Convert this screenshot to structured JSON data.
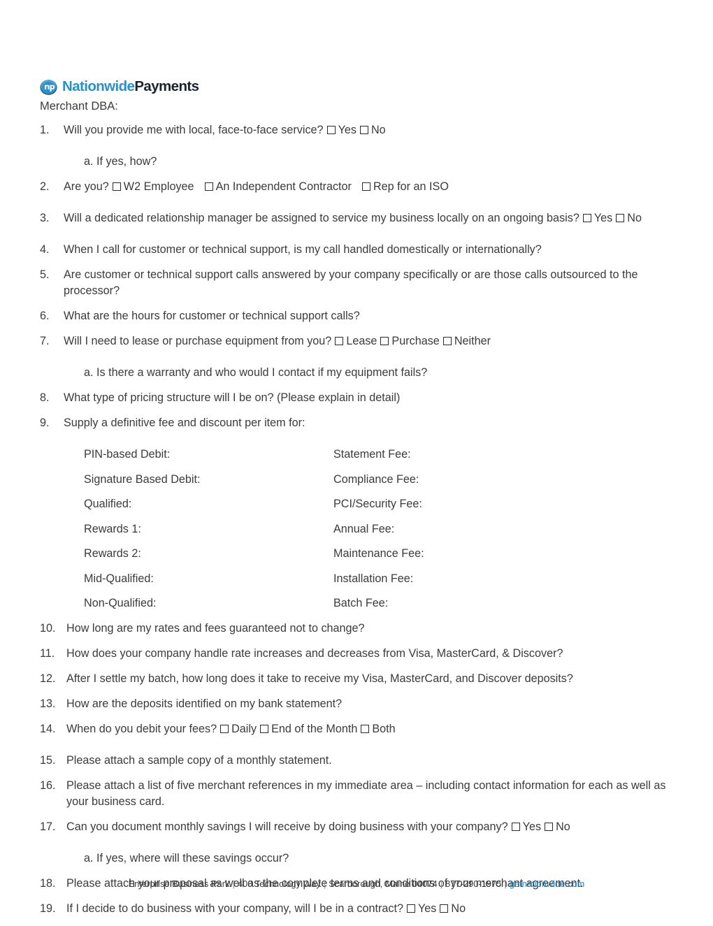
{
  "logo": {
    "mark_alt": "np-circle-logo",
    "word_primary": "Nationwide",
    "word_secondary": "Payments",
    "primary_color": "#2b8fc9",
    "secondary_color": "#1a2430"
  },
  "header": {
    "merchant_dba_label": "Merchant DBA:"
  },
  "questions": [
    {
      "num": "1.",
      "text": "Will you provide me with local, face-to-face service?",
      "options": [
        "Yes",
        "No"
      ]
    },
    {
      "num": "2.",
      "text": "Are you?",
      "options": [
        "W2 Employee",
        "An Independent Contractor",
        "Rep for an ISO"
      ]
    },
    {
      "num": "3.",
      "text": "Will a dedicated relationship manager be assigned to service my business locally on an ongoing basis?",
      "options": [
        "Yes",
        "No"
      ]
    },
    {
      "num": "4.",
      "text": "When I call for customer or technical support, is my call handled domestically or internationally?",
      "options": []
    },
    {
      "num": "5.",
      "text": "Are customer or technical support calls answered by your company specifically or are those calls outsourced to the processor?",
      "options": []
    },
    {
      "num": "6.",
      "text": "What are the hours for customer or technical support calls?",
      "options": []
    },
    {
      "num": "7.",
      "text": "Will I need to lease or purchase equipment from you?",
      "options": [
        "Lease",
        "Purchase",
        "Neither"
      ]
    },
    {
      "num": "8.",
      "text": "What type of pricing structure will I be on? (Please explain in detail)",
      "options": []
    },
    {
      "num": "9.",
      "text": "Supply a definitive fee and discount per item for:",
      "options": []
    },
    {
      "num": "10.",
      "text": "How long are my rates and fees guaranteed not to change?",
      "options": []
    },
    {
      "num": "11.",
      "text": "How does your company handle rate increases and decreases from Visa, MasterCard, & Discover?",
      "options": []
    },
    {
      "num": "12.",
      "text": "After I settle my batch, how long does it take to receive my Visa, MasterCard, and Discover deposits?",
      "options": []
    },
    {
      "num": "13.",
      "text": "How are the deposits identified on my bank statement?",
      "options": []
    },
    {
      "num": "14.",
      "text": "When do you debit your fees?",
      "options": [
        "Daily",
        "End of the Month",
        "Both"
      ]
    },
    {
      "num": "15.",
      "text": "Please attach a sample copy of a monthly statement.",
      "options": []
    },
    {
      "num": "16.",
      "text": "Please attach a list of five merchant references in my immediate area – including contact information for each as well as your business card.",
      "options": []
    },
    {
      "num": "17.",
      "text": "Can you document monthly savings I will receive by doing business with your company?",
      "options": [
        "Yes",
        "No"
      ]
    },
    {
      "num": "18.",
      "text": "Please attach your proposal as well as the complete terms and conditions of your merchant agreement.",
      "options": []
    },
    {
      "num": "19.",
      "text": "If I decide to do business with your company, will I be in a contract?",
      "options": [
        "Yes",
        "No"
      ]
    }
  ],
  "subquestions": {
    "q1a": "a. If yes, how?",
    "q7a": "a. Is there a warranty and who would I contact if my equipment fails?",
    "q17a": "a. If yes, where will these savings occur?"
  },
  "fee_table": {
    "rows": [
      {
        "left": "PIN-based Debit:",
        "right": "Statement Fee:"
      },
      {
        "left": "Signature Based Debit:",
        "right": "Compliance Fee:"
      },
      {
        "left": "Qualified:",
        "right": "PCI/Security Fee:"
      },
      {
        "left": "Rewards 1:",
        "right": "Annual Fee:"
      },
      {
        "left": "Rewards 2:",
        "right": "Maintenance Fee:"
      },
      {
        "left": "Mid-Qualified:",
        "right": "Installation Fee:"
      },
      {
        "left": "Non-Qualified:",
        "right": "Batch Fee:"
      }
    ]
  },
  "footer": {
    "park": "Enterprise Business Park",
    "street": "400 Technology Way",
    "city_state_zip": "Scarborough, Maine 04074",
    "phone": "877-290-1975",
    "website": "getnationwide.com",
    "separator": "|",
    "link_color": "#2e7bb0"
  }
}
